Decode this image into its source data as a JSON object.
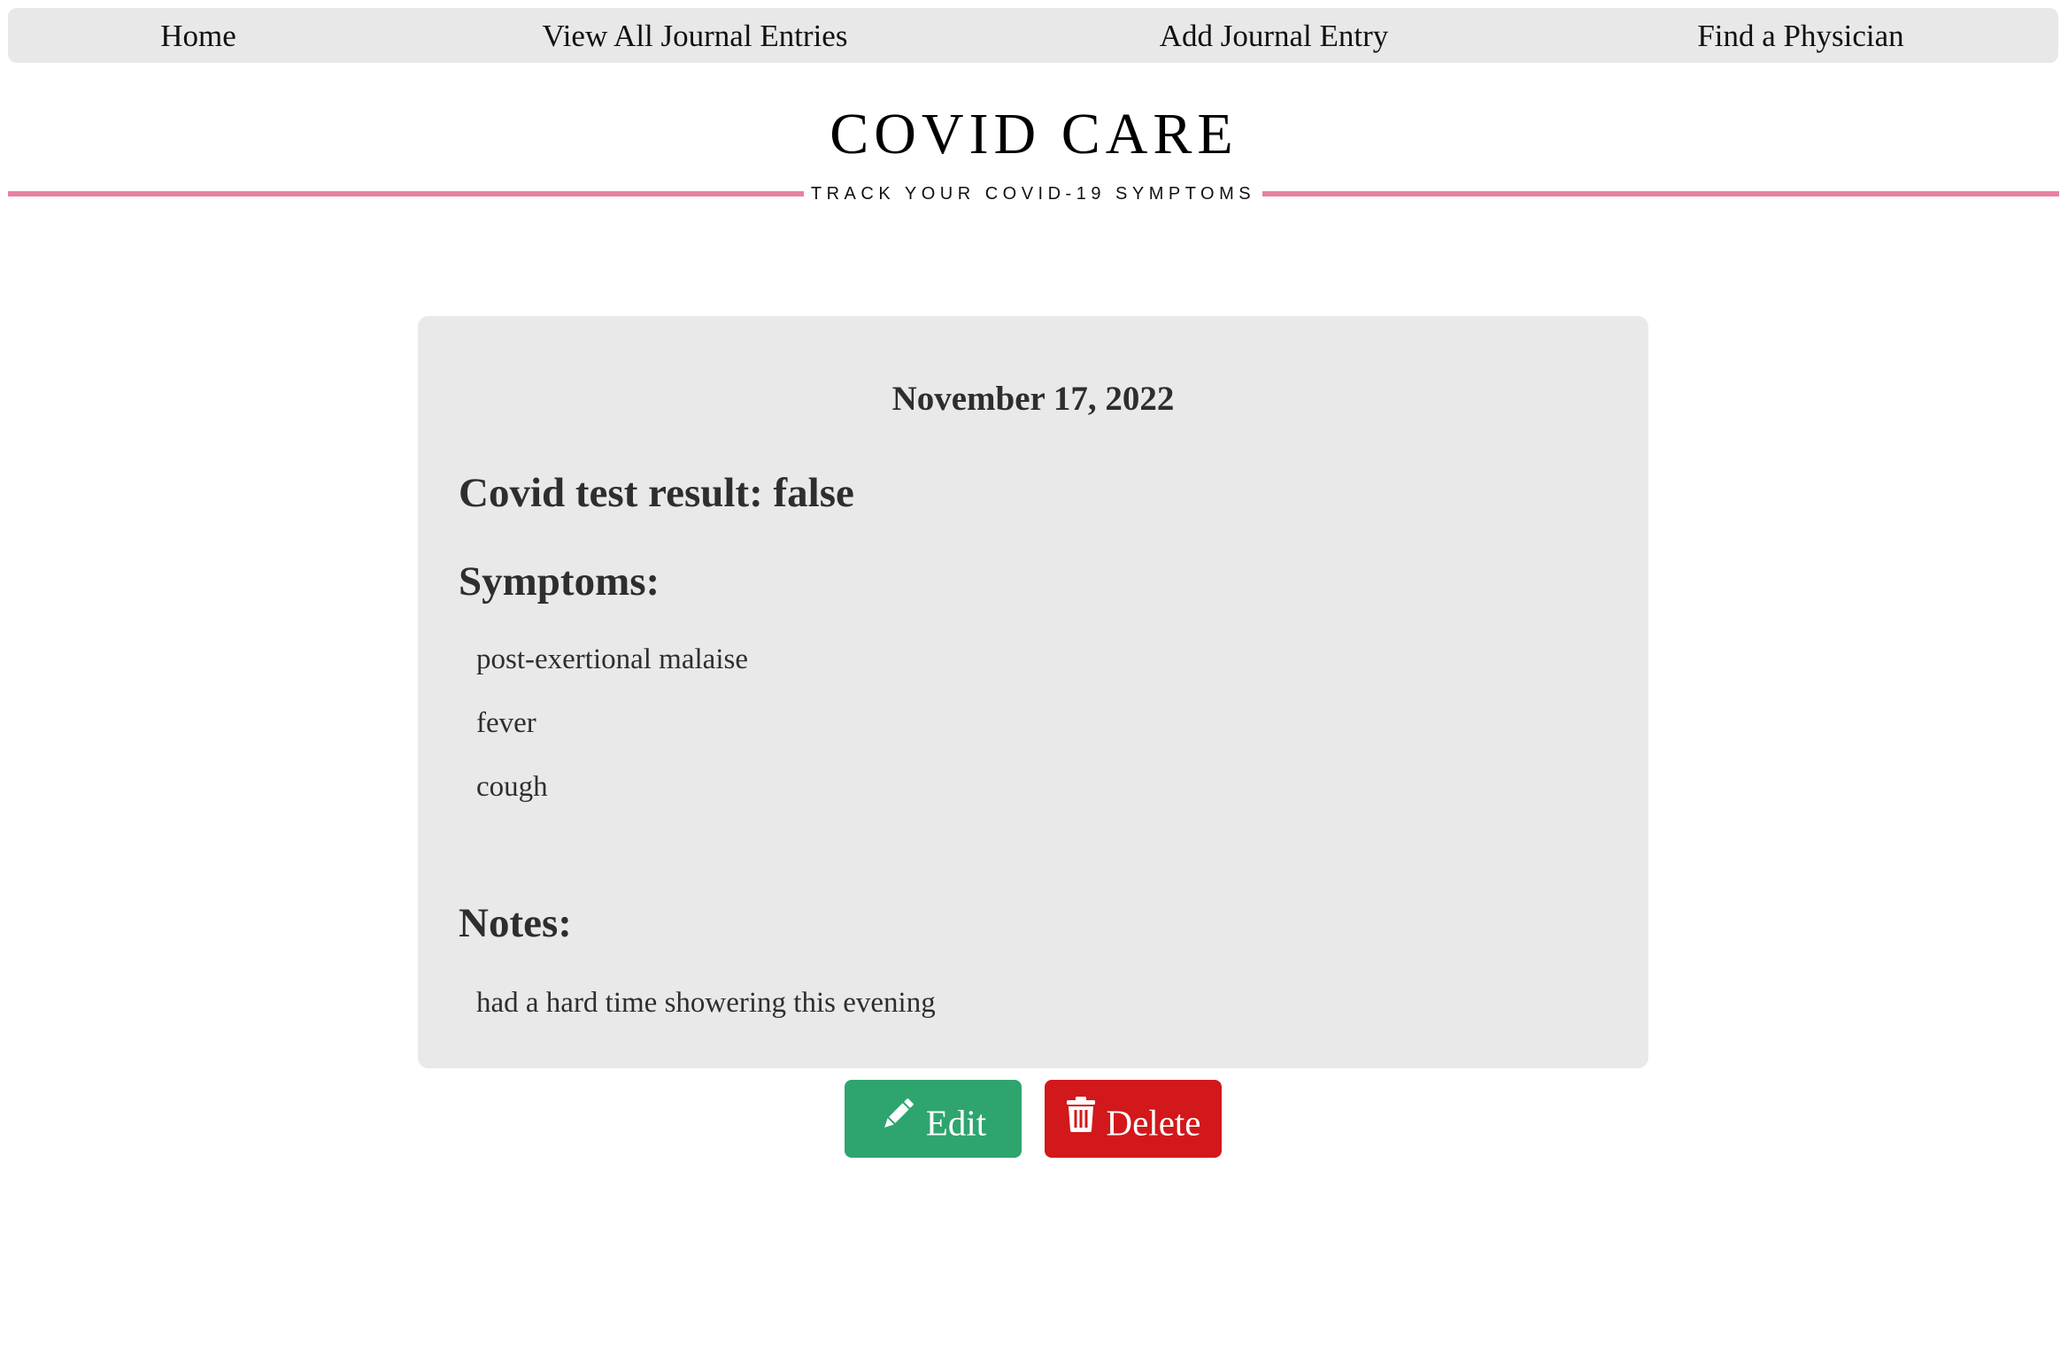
{
  "nav": {
    "items": [
      {
        "label": "Home"
      },
      {
        "label": "View All Journal Entries"
      },
      {
        "label": "Add Journal Entry"
      },
      {
        "label": "Find a Physician"
      }
    ]
  },
  "header": {
    "title": "COVID CARE",
    "subtitle": "TRACK YOUR COVID-19 SYMPTOMS"
  },
  "entry": {
    "date": "November 17, 2022",
    "test_result_text": "Covid test result: false",
    "symptoms_heading": "Symptoms:",
    "symptoms": [
      "post-exertional malaise",
      "fever",
      "cough"
    ],
    "notes_heading": "Notes:",
    "notes": "had a hard time showering this evening"
  },
  "actions": {
    "edit_label": "Edit",
    "edit_icon": "pencil-icon",
    "delete_label": "Delete",
    "delete_icon": "trash-icon"
  },
  "colors": {
    "accent_rule": "#e7819f",
    "edit_button": "#2ea56e",
    "delete_button": "#d2181b",
    "card_background": "#e9e9e9",
    "nav_background": "#e8e8e8"
  }
}
